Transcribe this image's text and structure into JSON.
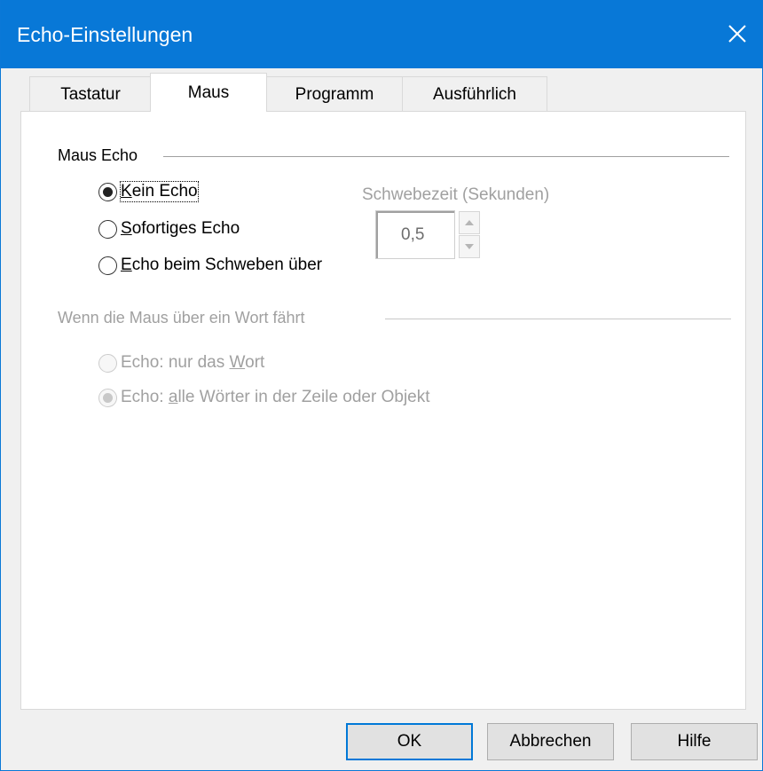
{
  "window": {
    "title": "Echo-Einstellungen"
  },
  "tabs": [
    {
      "label": "Tastatur",
      "active": false
    },
    {
      "label": "Maus",
      "active": true
    },
    {
      "label": "Programm",
      "active": false
    },
    {
      "label": "Ausführlich",
      "active": false
    }
  ],
  "mouse_echo": {
    "group_label": "Maus Echo",
    "options": [
      {
        "prefix": "",
        "accel": "K",
        "rest": "ein Echo",
        "selected": true
      },
      {
        "prefix": "",
        "accel": "S",
        "rest": "ofortiges Echo",
        "selected": false
      },
      {
        "prefix": "",
        "accel": "E",
        "rest": "cho beim Schweben über",
        "selected": false
      }
    ],
    "hover_label": "Schwebezeit (Sekunden)",
    "hover_value": "0,5"
  },
  "word_hover": {
    "group_label": "Wenn die Maus über ein Wort fährt",
    "options": [
      {
        "prefix": "Echo: nur das ",
        "accel": "W",
        "rest": "ort",
        "selected": false,
        "enabled": false
      },
      {
        "prefix": "Echo: ",
        "accel": "a",
        "rest": "lle Wörter in der Zeile oder Objekt",
        "selected": true,
        "enabled": false
      }
    ]
  },
  "buttons": {
    "ok": "OK",
    "cancel": "Abbrechen",
    "help": "Hilfe"
  },
  "colors": {
    "titlebar": "#0878d7",
    "disabled_text": "#a0a0a0"
  },
  "icons": {
    "close": "close-icon",
    "spin_up": "spin-up-icon",
    "spin_down": "spin-down-icon"
  }
}
